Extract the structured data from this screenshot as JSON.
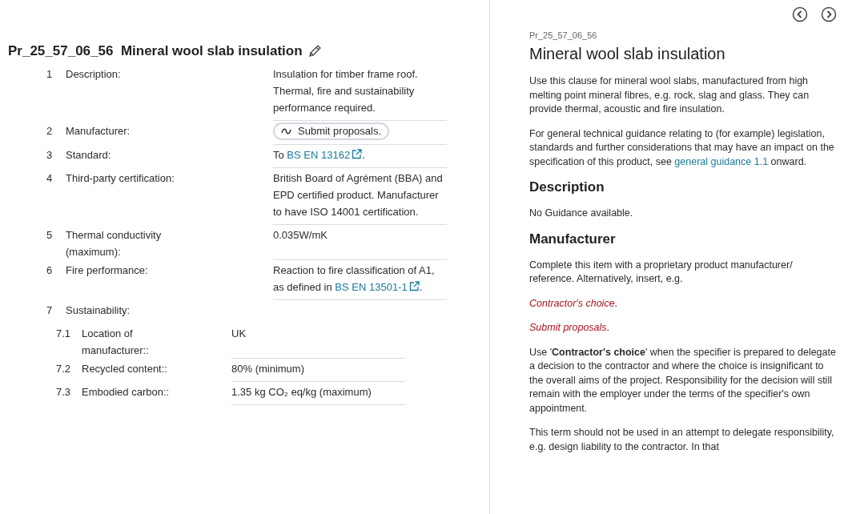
{
  "clause": {
    "code": "Pr_25_57_06_56",
    "title": "Mineral wool slab insulation",
    "rows": [
      {
        "number": "1",
        "label": "Description:",
        "kind": "text",
        "parts": [
          {
            "kind": "text",
            "text": "Insulation for timber frame roof. Thermal, fire and sustainability performance required."
          }
        ]
      },
      {
        "number": "2",
        "label": "Manufacturer:",
        "kind": "chip",
        "text": "Submit proposals."
      },
      {
        "number": "3",
        "label": "Standard:",
        "kind": "text",
        "parts": [
          {
            "kind": "text",
            "text": "To "
          },
          {
            "kind": "link",
            "text": "BS EN 13162"
          },
          {
            "kind": "text",
            "text": "."
          }
        ]
      },
      {
        "number": "4",
        "label": "Third-party certification:",
        "kind": "text",
        "parts": [
          {
            "kind": "text",
            "text": "British Board of Agrément (BBA) and EPD certified product. Manufacturer to have ISO 14001 certification."
          }
        ]
      },
      {
        "number": "5",
        "label": "Thermal conductivity (maximum):",
        "kind": "text",
        "parts": [
          {
            "kind": "text",
            "text": "0.035W/mK"
          }
        ]
      },
      {
        "number": "6",
        "label": "Fire performance:",
        "kind": "text",
        "parts": [
          {
            "kind": "text",
            "text": "Reaction to fire classification of A1, as defined in "
          },
          {
            "kind": "link",
            "text": "BS EN 13501-1"
          },
          {
            "kind": "text",
            "text": "."
          }
        ]
      },
      {
        "number": "7",
        "label": "Sustainability:",
        "kind": "group",
        "children": [
          {
            "number": "7.1",
            "label": "Location of manufacturer::",
            "kind": "text",
            "parts": [
              {
                "kind": "text",
                "text": "UK"
              }
            ]
          },
          {
            "number": "7.2",
            "label": "Recycled content::",
            "kind": "text",
            "parts": [
              {
                "kind": "text",
                "text": "80% (minimum)"
              }
            ]
          },
          {
            "number": "7.3",
            "label": "Embodied carbon::",
            "kind": "text",
            "parts": [
              {
                "kind": "text",
                "text": "1.35 kg CO₂ eq/kg (maximum)"
              }
            ]
          }
        ]
      }
    ]
  },
  "guidance": {
    "code": "Pr_25_57_06_56",
    "title": "Mineral wool slab insulation",
    "blocks": [
      {
        "kind": "para",
        "parts": [
          {
            "kind": "text",
            "text": "Use this clause for mineral wool slabs, manufactured from high melting point mineral fibres, e.g. rock, slag and glass. They can provide thermal, acoustic and fire insulation."
          }
        ]
      },
      {
        "kind": "para",
        "parts": [
          {
            "kind": "text",
            "text": "For general technical guidance relating to (for example) legislation, standards and further considerations that may have an impact on the specification of this product, see "
          },
          {
            "kind": "link",
            "text": "general guidance 1.1"
          },
          {
            "kind": "text",
            "text": " onward."
          }
        ]
      },
      {
        "kind": "heading",
        "text": "Description"
      },
      {
        "kind": "para",
        "parts": [
          {
            "kind": "text",
            "text": "No Guidance available."
          }
        ]
      },
      {
        "kind": "heading",
        "text": "Manufacturer"
      },
      {
        "kind": "para",
        "parts": [
          {
            "kind": "text",
            "text": "Complete this item with a proprietary product manufacturer/ reference. Alternatively, insert, e.g."
          }
        ]
      },
      {
        "kind": "option",
        "text": "Contractor's choice",
        "suffix": "."
      },
      {
        "kind": "option",
        "text": "Submit proposals",
        "suffix": "."
      },
      {
        "kind": "para",
        "parts": [
          {
            "kind": "text",
            "text": "Use '**Contractor's choice**' when the specifier is prepared to delegate a decision to the contractor and where the choice is insignificant to the overall aims of the project. Responsibility for the decision will still remain with the employer under the terms of the specifier's own appointment."
          }
        ]
      },
      {
        "kind": "para",
        "parts": [
          {
            "kind": "text",
            "text": "This term should not be used in an attempt to delegate responsibility, e.g. design liability to the contractor. In that"
          }
        ]
      }
    ]
  }
}
